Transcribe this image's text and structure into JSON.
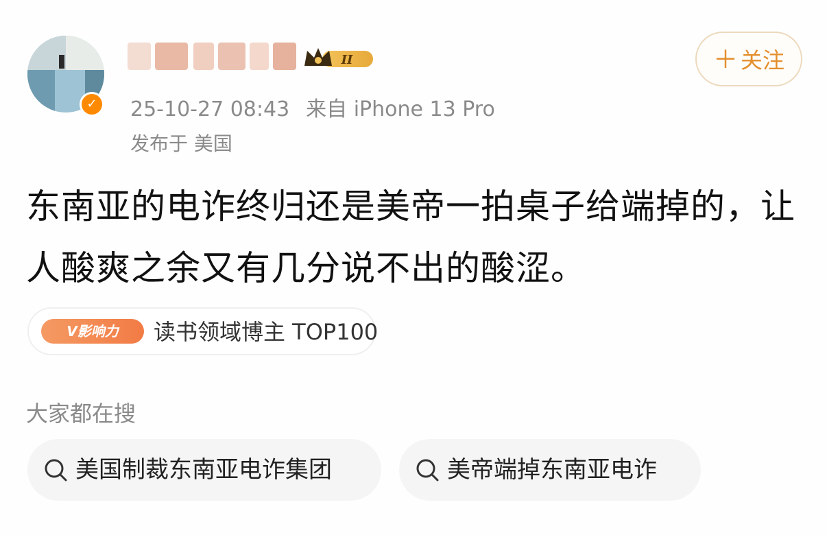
{
  "post": {
    "timestamp": "25-10-27 08:43",
    "source": "来自 iPhone 13 Pro",
    "location": "发布于 美国",
    "follow_label": "关注",
    "follow_icon": "plus-icon",
    "text": "东南亚的电诈终归还是美帝一拍桌子给端掉的，让人酸爽之余又有几分说不出的酸涩。",
    "member_level": "II"
  },
  "influence": {
    "tag": "V影响力",
    "label": "读书领域博主 TOP100"
  },
  "search": {
    "heading": "大家都在搜",
    "items": [
      {
        "label": "美国制裁东南亚电诈集团",
        "icon": "search-icon"
      },
      {
        "label": "美帝端掉东南亚电诈",
        "icon": "search-icon"
      }
    ]
  },
  "colors": {
    "accent": "#e38f2e",
    "muted_text": "#8a8a8a",
    "influence_tag": "#f27b45",
    "chip_bg": "#f5f5f5"
  }
}
